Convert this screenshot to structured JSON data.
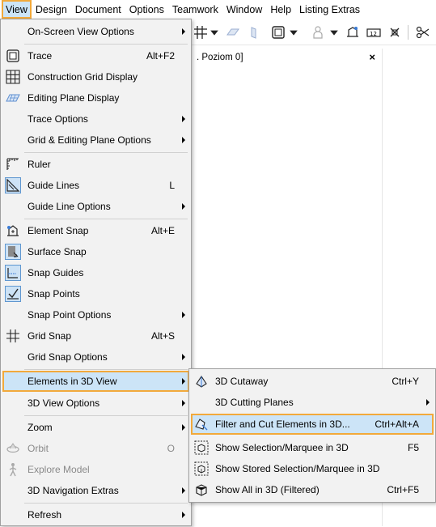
{
  "menubar": {
    "items": [
      "View",
      "Design",
      "Document",
      "Options",
      "Teamwork",
      "Window",
      "Help",
      "Listing Extras"
    ]
  },
  "doc_tab": {
    "title": ". Poziom 0]",
    "close": "×"
  },
  "view_menu": {
    "on_screen_view_options": "On-Screen View Options",
    "trace": "Trace",
    "trace_sc": "Alt+F2",
    "construction_grid_display": "Construction Grid Display",
    "editing_plane_display": "Editing Plane Display",
    "trace_options": "Trace Options",
    "grid_editing_plane_options": "Grid & Editing Plane Options",
    "ruler": "Ruler",
    "guide_lines": "Guide Lines",
    "guide_lines_sc": "L",
    "guide_line_options": "Guide Line Options",
    "element_snap": "Element Snap",
    "element_snap_sc": "Alt+E",
    "surface_snap": "Surface Snap",
    "snap_guides": "Snap Guides",
    "snap_points": "Snap Points",
    "snap_point_options": "Snap Point Options",
    "grid_snap": "Grid Snap",
    "grid_snap_sc": "Alt+S",
    "grid_snap_options": "Grid Snap Options",
    "elements_in_3d_view": "Elements in 3D View",
    "view_3d_options": "3D View Options",
    "zoom": "Zoom",
    "orbit": "Orbit",
    "orbit_sc": "O",
    "explore_model": "Explore Model",
    "nav_3d_extras": "3D Navigation Extras",
    "refresh": "Refresh"
  },
  "submenu": {
    "cutaway": "3D Cutaway",
    "cutaway_sc": "Ctrl+Y",
    "cutting_planes": "3D Cutting Planes",
    "filter_cut": "Filter and Cut Elements in 3D...",
    "filter_cut_sc": "Ctrl+Alt+A",
    "show_selection": "Show Selection/Marquee in 3D",
    "show_selection_sc": "F5",
    "show_stored": "Show Stored Selection/Marquee in 3D",
    "show_all": "Show All in 3D (Filtered)",
    "show_all_sc": "Ctrl+F5"
  },
  "colors": {
    "highlight": "#cce4f7",
    "focus_border": "#f2a93b",
    "menu_bg": "#f2f2f2"
  }
}
